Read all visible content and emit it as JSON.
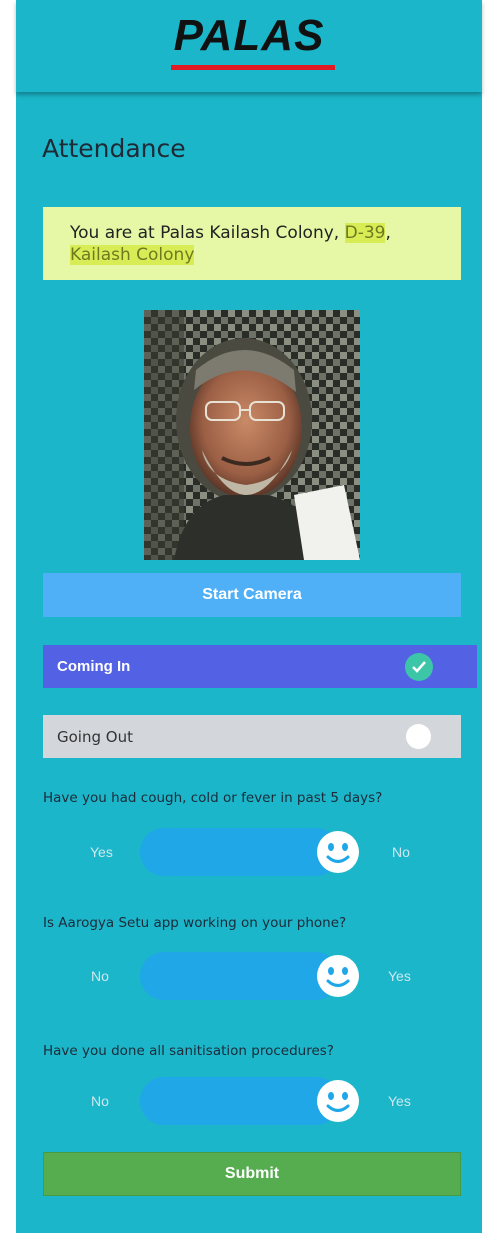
{
  "header": {
    "logo_text": "PALAS"
  },
  "page_title": "Attendance",
  "location": {
    "prefix": "You are at Palas Kailash Colony, ",
    "highlight_1": "D-39",
    "separator": ",",
    "highlight_2": "Kailash Colony"
  },
  "camera": {
    "button_label": "Start Camera"
  },
  "direction": {
    "coming_in_label": "Coming In",
    "coming_in_selected": true,
    "going_out_label": "Going Out",
    "going_out_selected": false
  },
  "questions": [
    {
      "text": "Have you had cough, cold or fever in past 5 days?",
      "left": "Yes",
      "right": "No"
    },
    {
      "text": "Is Aarogya Setu app working on your phone?",
      "left": "No",
      "right": "Yes"
    },
    {
      "text": "Have you done all sanitisation procedures?",
      "left": "No",
      "right": "Yes"
    }
  ],
  "submit_label": "Submit",
  "colors": {
    "background": "#1bb6c9",
    "coming_in": "#5362e4",
    "camera_button": "#4fb0f7",
    "submit": "#55ad4f",
    "location_box": "#e6f8a6"
  }
}
